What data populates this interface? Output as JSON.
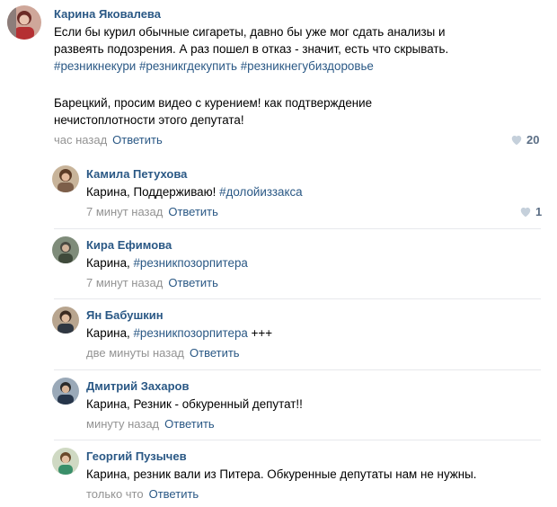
{
  "main_comment": {
    "author": "Карина Яковалева",
    "line1": "Если бы курил обычные сигареты, давно бы уже мог сдать анализы и",
    "line2": "развеять подозрения. А раз пошел в отказ - значит, есть что скрывать.",
    "tags": "#резникнекури #резникгдекупить #резникнегубиздоровье",
    "line4": "Барецкий, просим видео с курением! как подтверждение",
    "line5": "нечистоплотности этого депутата!",
    "time": "час назад",
    "reply": "Ответить",
    "likes": "20"
  },
  "replies": [
    {
      "author": "Камила Петухова",
      "prefix": "Карина, Поддерживаю! ",
      "tag": "#долойиззакса",
      "suffix": "",
      "time": "7 минут назад",
      "reply": "Ответить",
      "likes": "1"
    },
    {
      "author": "Кира Ефимова",
      "prefix": "Карина, ",
      "tag": "#резникпозорпитера",
      "suffix": "",
      "time": "7 минут назад",
      "reply": "Ответить",
      "likes": ""
    },
    {
      "author": "Ян Бабушкин",
      "prefix": "Карина, ",
      "tag": "#резникпозорпитера",
      "suffix": " +++",
      "time": "две минуты назад",
      "reply": "Ответить",
      "likes": ""
    },
    {
      "author": "Дмитрий Захаров",
      "prefix": "Карина, Резник - обкуренный депутат!!",
      "tag": "",
      "suffix": "",
      "time": "минуту назад",
      "reply": "Ответить",
      "likes": ""
    },
    {
      "author": "Георгий Пузычев",
      "prefix": "Карина, резник вали из Питера. Обкуренные депутаты нам не нужны.",
      "tag": "",
      "suffix": "",
      "time": "только что",
      "reply": "Ответить",
      "likes": ""
    }
  ],
  "icons": {
    "like": "heart-icon"
  },
  "colors": {
    "link": "#2a5885",
    "meta": "#939393",
    "divider": "#e7e8ec"
  }
}
